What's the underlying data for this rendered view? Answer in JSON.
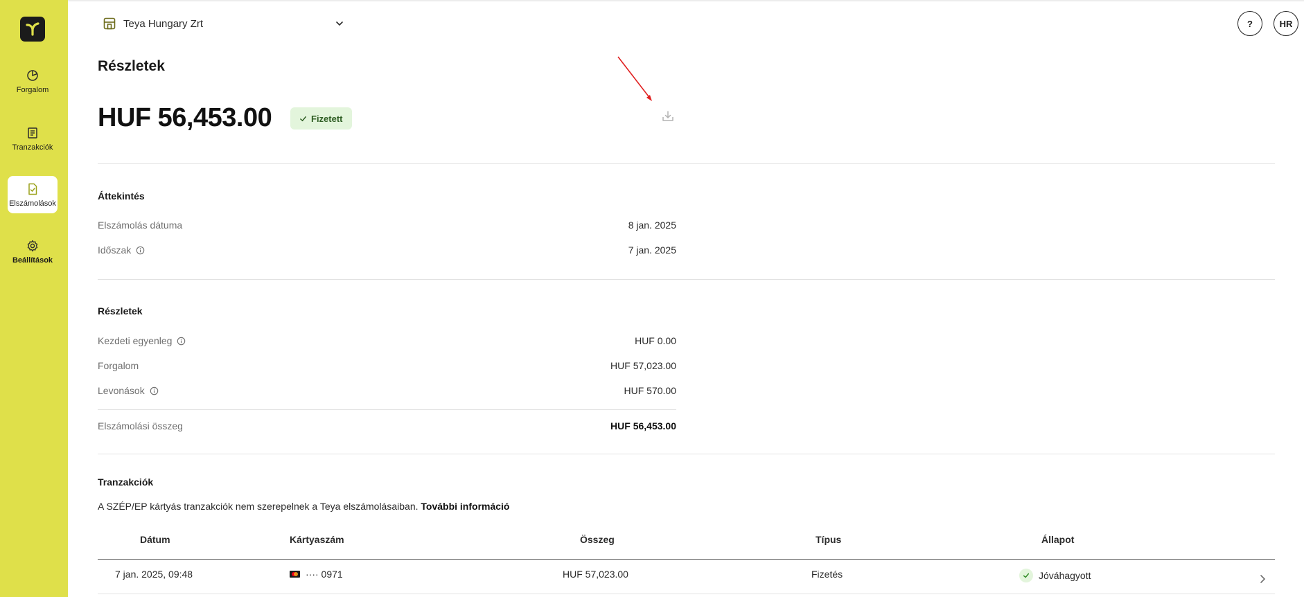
{
  "sidebar": {
    "logo_icon": "teya-logo-icon",
    "items": [
      {
        "label": "Forgalom",
        "icon": "pie-chart-icon",
        "active": false
      },
      {
        "label": "Tranzakciók",
        "icon": "receipt-icon",
        "active": false
      },
      {
        "label": "Elszámolások",
        "icon": "document-check-icon",
        "active": true
      },
      {
        "label": "Beállítások",
        "icon": "gear-icon",
        "active": false
      }
    ]
  },
  "header": {
    "company_name": "Teya Hungary Zrt",
    "help_label": "?",
    "avatar_initials": "HR"
  },
  "page": {
    "title": "Részletek",
    "amount": "HUF 56,453.00",
    "status": "Fizetett"
  },
  "overview": {
    "title": "Áttekintés",
    "rows": [
      {
        "label": "Elszámolás dátuma",
        "value": "8 jan. 2025"
      },
      {
        "label": "Időszak",
        "value": "7 jan. 2025"
      }
    ]
  },
  "details": {
    "title": "Részletek",
    "rows": [
      {
        "label": "Kezdeti egyenleg",
        "value": "HUF 0.00"
      },
      {
        "label": "Forgalom",
        "value": "HUF 57,023.00"
      },
      {
        "label": "Levonások",
        "value": "HUF 570.00"
      }
    ],
    "total_label": "Elszámolási összeg",
    "total_value": "HUF 56,453.00"
  },
  "transactions": {
    "title": "Tranzakciók",
    "notice": "A SZÉP/EP kártyás tranzakciók nem szerepelnek a Teya elszámolásaiban.",
    "notice_link": "További információ",
    "columns": [
      "Dátum",
      "Kártyaszám",
      "Összeg",
      "Típus",
      "Állapot"
    ],
    "rows": [
      {
        "date": "7 jan. 2025, 09:48",
        "card": "···· 0971",
        "amount": "HUF 57,023.00",
        "type": "Fizetés",
        "status": "Jóváhagyott"
      }
    ]
  },
  "colors": {
    "sidebar_bg": "#dfe04a",
    "badge_bg": "#e3f5dc",
    "badge_text": "#2f5e24",
    "annotation_arrow": "#e02020"
  }
}
